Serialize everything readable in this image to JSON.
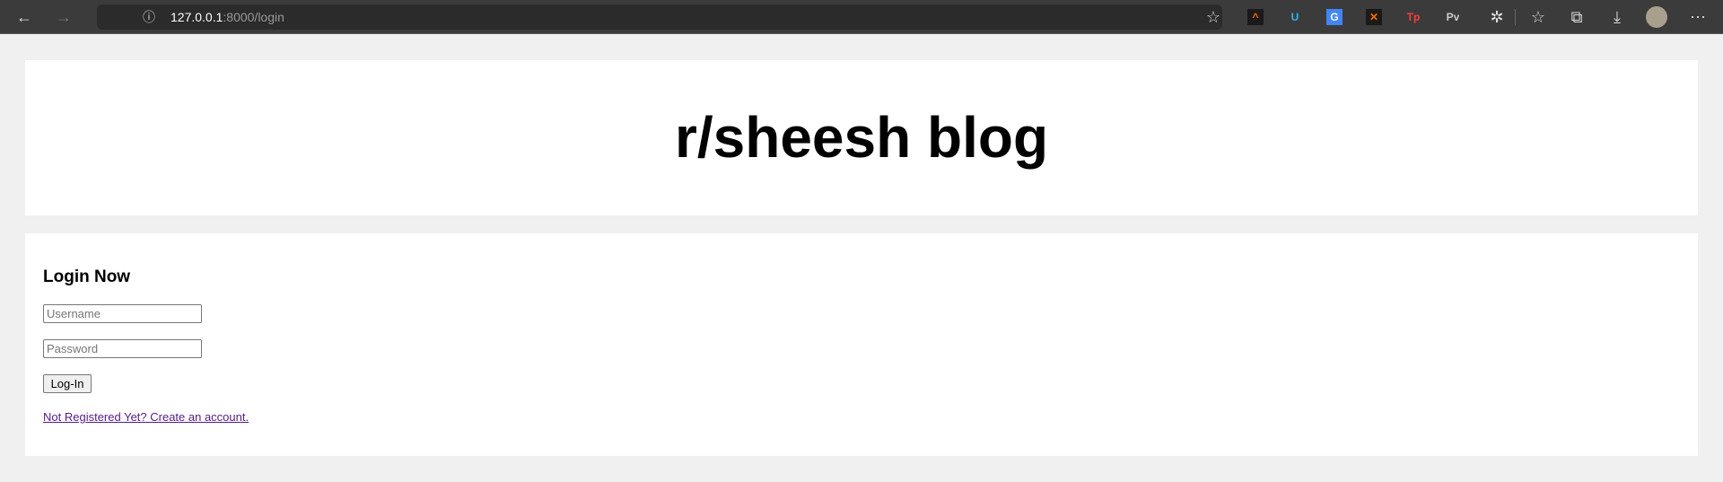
{
  "browser": {
    "url_host": "127.0.0.1",
    "url_path": ":8000/login",
    "extensions": [
      {
        "name": "ext-chevrons",
        "glyph": "^",
        "color": "#ff6a00",
        "bg": "#1a1a1a"
      },
      {
        "name": "ext-owl",
        "glyph": "U",
        "color": "#29b6f6",
        "bg": "transparent"
      },
      {
        "name": "ext-google-translate",
        "glyph": "G",
        "color": "#fff",
        "bg": "#4285f4"
      },
      {
        "name": "ext-x",
        "glyph": "✕",
        "color": "#ff6a00",
        "bg": "#1a1a1a"
      },
      {
        "name": "ext-tp",
        "glyph": "Tp",
        "color": "#ff3b3b",
        "bg": "transparent"
      },
      {
        "name": "ext-pv",
        "glyph": "Pv",
        "color": "#ccc",
        "bg": "transparent"
      }
    ]
  },
  "header": {
    "title": "r/sheesh blog"
  },
  "login": {
    "heading": "Login Now",
    "username_placeholder": "Username",
    "password_placeholder": "Password",
    "submit_label": "Log-In",
    "register_link": "Not Registered Yet? Create an account."
  }
}
